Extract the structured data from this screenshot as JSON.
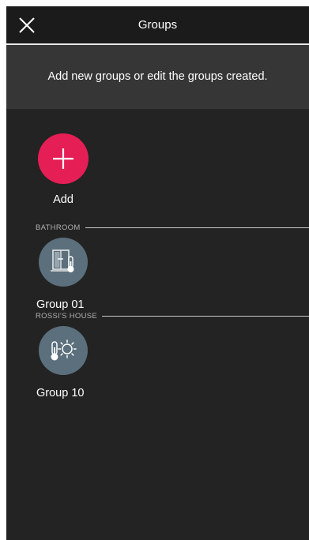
{
  "header": {
    "title": "Groups",
    "close_icon": "close-icon"
  },
  "info": {
    "text": "Add new groups or edit the groups created."
  },
  "add": {
    "label": "Add",
    "icon": "plus-icon",
    "color": "#e51e56"
  },
  "sections": [
    {
      "label": "BATHROOM",
      "groups": [
        {
          "label": "Group 01",
          "icon": "window-thermometer-icon"
        }
      ]
    },
    {
      "label": "ROSSI'S HOUSE",
      "groups": [
        {
          "label": "Group 10",
          "icon": "thermometer-sun-icon"
        }
      ]
    }
  ],
  "colors": {
    "background": "#232323",
    "header": "#1b1b1b",
    "info_band": "#363636",
    "group_circle": "#5b6f7c",
    "accent": "#e51e56"
  }
}
